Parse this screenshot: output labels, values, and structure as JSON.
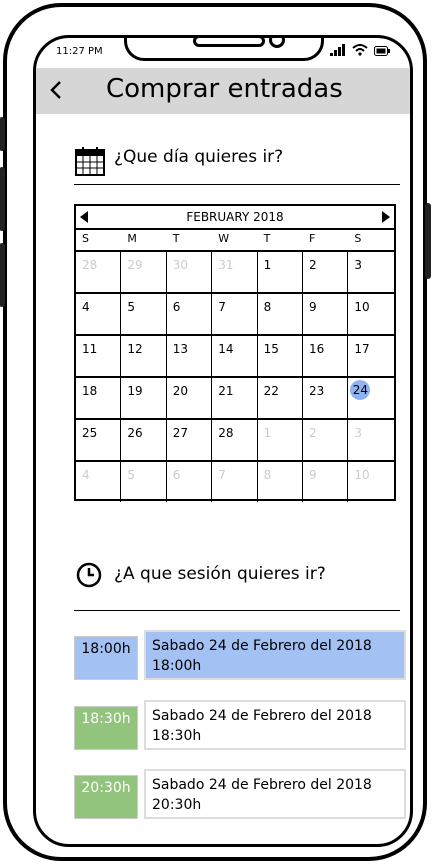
{
  "status": {
    "time": "11:27 PM"
  },
  "header": {
    "title": "Comprar entradas"
  },
  "day_section": {
    "label": "¿Que día quieres ir?"
  },
  "calendar": {
    "month": "FEBRUARY 2018",
    "weekdays": [
      "S",
      "M",
      "T",
      "W",
      "T",
      "F",
      "S"
    ],
    "weeks": [
      [
        [
          "28",
          true
        ],
        [
          "29",
          true
        ],
        [
          "30",
          true
        ],
        [
          "31",
          true
        ],
        [
          "1",
          false
        ],
        [
          "2",
          false
        ],
        [
          "3",
          false
        ]
      ],
      [
        [
          "4",
          false
        ],
        [
          "5",
          false
        ],
        [
          "6",
          false
        ],
        [
          "7",
          false
        ],
        [
          "8",
          false
        ],
        [
          "9",
          false
        ],
        [
          "10",
          false
        ]
      ],
      [
        [
          "11",
          false
        ],
        [
          "12",
          false
        ],
        [
          "13",
          false
        ],
        [
          "14",
          false
        ],
        [
          "15",
          false
        ],
        [
          "16",
          false
        ],
        [
          "17",
          false
        ]
      ],
      [
        [
          "18",
          false
        ],
        [
          "19",
          false
        ],
        [
          "20",
          false
        ],
        [
          "21",
          false
        ],
        [
          "22",
          false
        ],
        [
          "23",
          false
        ],
        [
          "24",
          false
        ]
      ],
      [
        [
          "25",
          false
        ],
        [
          "26",
          false
        ],
        [
          "27",
          false
        ],
        [
          "28",
          false
        ],
        [
          "1",
          true
        ],
        [
          "2",
          true
        ],
        [
          "3",
          true
        ]
      ],
      [
        [
          "4",
          true
        ],
        [
          "5",
          true
        ],
        [
          "6",
          true
        ],
        [
          "7",
          true
        ],
        [
          "8",
          true
        ],
        [
          "9",
          true
        ],
        [
          "10",
          true
        ]
      ]
    ],
    "selected_day": "24",
    "selected_color": "#8fb3f0"
  },
  "session_section": {
    "label": "¿A que sesión quieres ir?"
  },
  "sessions": [
    {
      "time": "18:00h",
      "line1": "Sabado 24 de Febrero del 2018",
      "line2": "18:00h",
      "time_color": "#a3c1f2",
      "desc_color": "#a3c1f2",
      "time_text_color": "#000000"
    },
    {
      "time": "18:30h",
      "line1": "Sabado 24 de Febrero del 2018",
      "line2": "18:30h",
      "time_color": "#93c47d",
      "desc_color": "#ffffff",
      "time_text_color": "#ffffff"
    },
    {
      "time": "20:30h",
      "line1": "Sabado 24 de Febrero del 2018",
      "line2": "20:30h",
      "time_color": "#93c47d",
      "desc_color": "#ffffff",
      "time_text_color": "#ffffff"
    }
  ]
}
